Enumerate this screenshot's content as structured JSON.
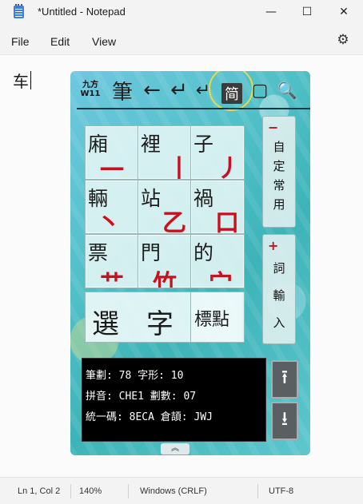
{
  "window": {
    "title": "*Untitled - Notepad",
    "minimize_glyph": "—",
    "maximize_glyph": "☐",
    "close_glyph": "✕"
  },
  "menu": {
    "items": [
      "File",
      "Edit",
      "View"
    ]
  },
  "editor": {
    "text": "车"
  },
  "ime": {
    "toolbar": {
      "logo_line1": "九方",
      "logo_line2": "W11",
      "strokes_label": "筆",
      "back_glyph": "←",
      "enter_glyph": "↵",
      "newline_glyph": "↵",
      "simplified_label": "简",
      "square_glyph": "▢",
      "search_glyph": "🔍"
    },
    "grid": [
      {
        "char": "廂",
        "stroke": "一"
      },
      {
        "char": "裡",
        "stroke": "丨"
      },
      {
        "char": "子",
        "stroke": "丿"
      },
      {
        "char": "輛",
        "stroke": "丶"
      },
      {
        "char": "站",
        "stroke": "乙"
      },
      {
        "char": "禍",
        "stroke": "口"
      },
      {
        "char": "票",
        "stroke": "艹"
      },
      {
        "char": "門",
        "stroke": "竹"
      },
      {
        "char": "的",
        "stroke": "宀"
      }
    ],
    "select_label": "選　字",
    "punctuation_label": "標點",
    "side_top": {
      "sign": "−",
      "chars": [
        "自",
        "定",
        "常",
        "用"
      ]
    },
    "side_bottom": {
      "sign": "+",
      "chars": [
        "詞",
        "輸",
        "入"
      ]
    },
    "info": {
      "line1": "筆劃: 78 字形: 10",
      "line2": "拼音: CHE1 劃數: 07",
      "line3": "統一碼: 8ECA 倉頡: JWJ"
    },
    "up_glyph": "⭱",
    "down_glyph": "⭳",
    "expand_glyph": "︽"
  },
  "status": {
    "position": "Ln 1, Col 2",
    "zoom": "140%",
    "line_ending": "Windows (CRLF)",
    "encoding": "UTF-8"
  },
  "colors": {
    "stroke_red": "#c8101e",
    "panel_teal": "#3db4b8",
    "ring_yellow": "#e8d94a"
  }
}
